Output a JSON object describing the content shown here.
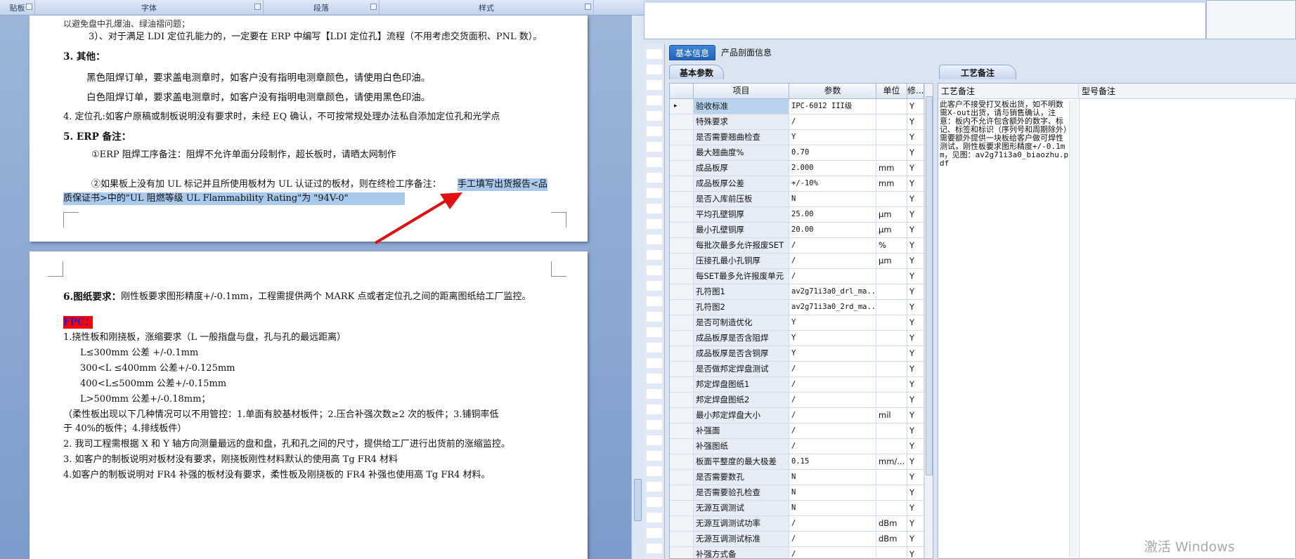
{
  "ribbon": {
    "groups": [
      {
        "label": "贴板"
      },
      {
        "label": "字体"
      },
      {
        "label": "段落"
      },
      {
        "label": "样式"
      }
    ]
  },
  "page1": {
    "lines": [
      "以避免盘中孔爆油、绿油褶问题；",
      "3）、对于满足 LDI 定位孔能力的，一定要在 ERP 中编写【LDI 定位孔】流程（不用考虑交货面积、PNL 数）。",
      "3. 其他：",
      "黑色阻焊订单，要求盖电测章时，如客户没有指明电测章颜色，请使用白色印油。",
      "白色阻焊订单，要求盖电测章时，如客户没有指明电测章颜色，请使用黑色印油。",
      "4. 定位孔:如客户原稿或制板说明没有要求时，未经 EQ 确认，不可按常规处理办法私自添加定位孔和光学点",
      "5. ERP 备注：",
      "①ERP 阻焊工序备注：阻焊不允许单面分段制作，超长板时，请晒太网制作",
      "②如果板上没有加 UL 标记并且所使用板材为 UL 认证过的板材，则在终检工序备注：",
      "手工填写出货报告<品",
      "质保证书>中的\"UL 阻燃等级 UL Flammability Rating\"为 \"94V-0\""
    ]
  },
  "page2": {
    "lines": [
      "6.图纸要求：",
      "刚性板要求图形精度+/-0.1mm，工程需提供两个 MARK 点或者定位孔之间的距离图纸给工厂监控。",
      "FPC：",
      "1.挠性板和刚挠板，涨缩要求（L 一般指盘与盘，孔与孔的最远距离）",
      "L≤300mm 公差 +/-0.1mm",
      "300<L ≤400mm 公差+/-0.125mm",
      "400<L≤500mm 公差+/-0.15mm",
      "L>500mm 公差+/-0.18mm；",
      "（柔性板出现以下几种情况可以不用管控：1.单面有胶基材板件；2.压合补强次数≥2 次的板件；3.铺铜率低",
      "于 40%的板件；4.排线板件）",
      "2.  我司工程需根据 X 和 Y 轴方向测量最远的盘和盘，孔和孔之间的尺寸，提供给工厂进行出货前的涨缩监控。",
      "3. 如客户的制板说明对板材没有要求，刚挠板刚性材料默认的使用高 Tg FR4 材料",
      "4.如客户的制板说明对 FR4 补强的板材没有要求，柔性板及刚挠板的 FR4 补强也使用高 Tg FR4 材料。"
    ]
  },
  "erp": {
    "main_tabs": [
      "基本信息",
      "产品剖面信息"
    ],
    "left_subtab": "基本参数",
    "right_subtab": "工艺备注",
    "columns": [
      "项目",
      "参数",
      "单位",
      "修..."
    ],
    "rows": [
      [
        "验收标准",
        "IPC-6012 III级",
        "",
        "Y"
      ],
      [
        "特殊要求",
        "/",
        "",
        "Y"
      ],
      [
        "是否需要翘曲检查",
        "Y",
        "",
        "Y"
      ],
      [
        "最大翘曲度%",
        "0.70",
        "",
        "Y"
      ],
      [
        "成品板厚",
        "2.000",
        "mm",
        "Y"
      ],
      [
        "成品板厚公差",
        "+/-10%",
        "mm",
        "Y"
      ],
      [
        "是否入库前压板",
        "N",
        "",
        "Y"
      ],
      [
        "平均孔壁铜厚",
        "25.00",
        "μm",
        "Y"
      ],
      [
        "最小孔壁铜厚",
        "20.00",
        "μm",
        "Y"
      ],
      [
        "每批次最多允许报废SET",
        "/",
        "%",
        "Y"
      ],
      [
        "压接孔最小孔铜厚",
        "/",
        "μm",
        "Y"
      ],
      [
        "每SET最多允许报废单元",
        "/",
        "",
        "Y"
      ],
      [
        "孔符图1",
        "av2g71i3a0_drl_ma...",
        "",
        "Y"
      ],
      [
        "孔符图2",
        "av2g71i3a0_2rd_ma...",
        "",
        "Y"
      ],
      [
        "是否可制造优化",
        "Y",
        "",
        "Y"
      ],
      [
        "成品板厚是否含阻焊",
        "Y",
        "",
        "Y"
      ],
      [
        "成品板厚是否含铜厚",
        "Y",
        "",
        "Y"
      ],
      [
        "是否做邦定焊盘测试",
        "/",
        "",
        "Y"
      ],
      [
        "邦定焊盘图纸1",
        "/",
        "",
        "Y"
      ],
      [
        "邦定焊盘图纸2",
        "/",
        "",
        "Y"
      ],
      [
        "最小邦定焊盘大小",
        "/",
        "mil",
        "Y"
      ],
      [
        "补强面",
        "/",
        "",
        "Y"
      ],
      [
        "补强图纸",
        "/",
        "",
        "Y"
      ],
      [
        "板面平整度的最大极差",
        "0.15",
        "mm/...",
        "Y"
      ],
      [
        "是否需要数孔",
        "N",
        "",
        "Y"
      ],
      [
        "是否需要验孔检查",
        "N",
        "",
        "Y"
      ],
      [
        "无源互调测试",
        "N",
        "",
        "Y"
      ],
      [
        "无源互调测试功率",
        "/",
        "dBm",
        "Y"
      ],
      [
        "无源互调测试标准",
        "/",
        "dBm",
        "Y"
      ],
      [
        "补强方式备",
        "/",
        "",
        "Y"
      ]
    ],
    "memo_headers": [
      "工艺备注",
      "型号备注"
    ],
    "process_note": "此客户不接受打叉板出货，如不明数需X-out出货，请与销售确认，注意：板内不允许包含额外的数字、标记、标签和标识（序列号和周期除外）需要额外提供一块板给客户做可焊性测试，刚性板要求图形精度+/-0.1mm，见图：av2g71i3a0_biaozhu.pdf"
  },
  "watermark": "激活 Windows",
  "colors": {
    "selection": "#a8c8ec",
    "blue_text": "#2222c8",
    "fpc_highlight": "#ff0000",
    "arrow": "#e01010",
    "tab_active": "#2a6cc4"
  }
}
